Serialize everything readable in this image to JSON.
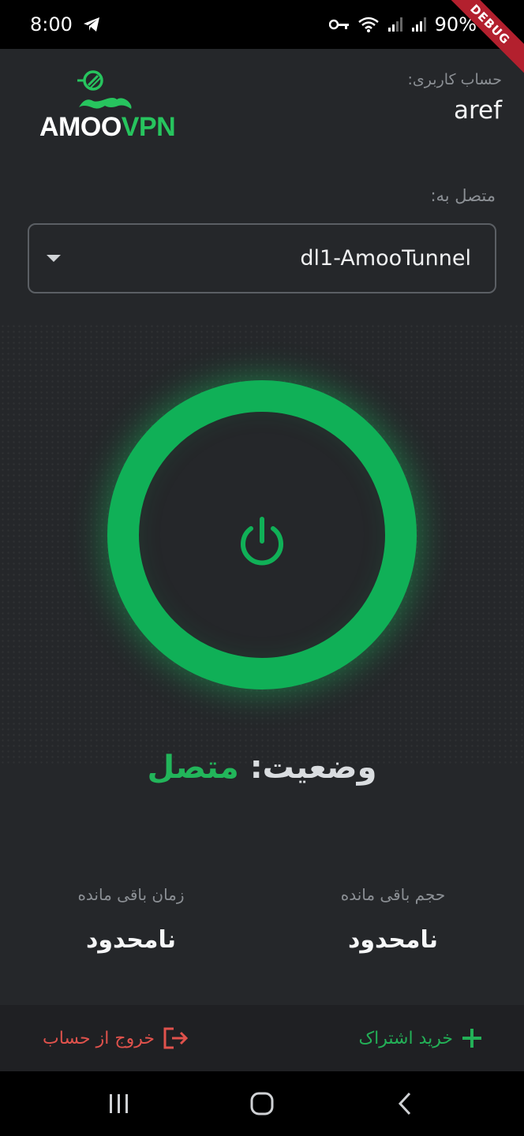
{
  "status_bar": {
    "time": "8:00",
    "battery": "90%",
    "debug_banner": "DEBUG"
  },
  "logo": {
    "amoo": "AMOO",
    "vpn": "VPN"
  },
  "account": {
    "label": "حساب کاربری:",
    "username": "aref"
  },
  "connection": {
    "label": "متصل به:",
    "server": "dl1-AmooTunnel"
  },
  "status": {
    "key": "وضعیت:",
    "value": "متصل"
  },
  "stats": {
    "time_remaining_label": "زمان باقی مانده",
    "time_remaining_value": "نامحدود",
    "volume_remaining_label": "حجم باقی مانده",
    "volume_remaining_value": "نامحدود"
  },
  "actions": {
    "logout_label": "خروج از حساب",
    "buy_label": "خرید اشتراک"
  },
  "colors": {
    "accent_green": "#10b057",
    "logout_red": "#e0524c",
    "background": "#25272a"
  },
  "icons": [
    "telegram-icon",
    "vpn-key-icon",
    "wifi-icon",
    "signal-icon",
    "battery-icon",
    "power-icon",
    "logout-icon",
    "plus-icon",
    "recent-apps-icon",
    "home-icon",
    "back-icon"
  ]
}
